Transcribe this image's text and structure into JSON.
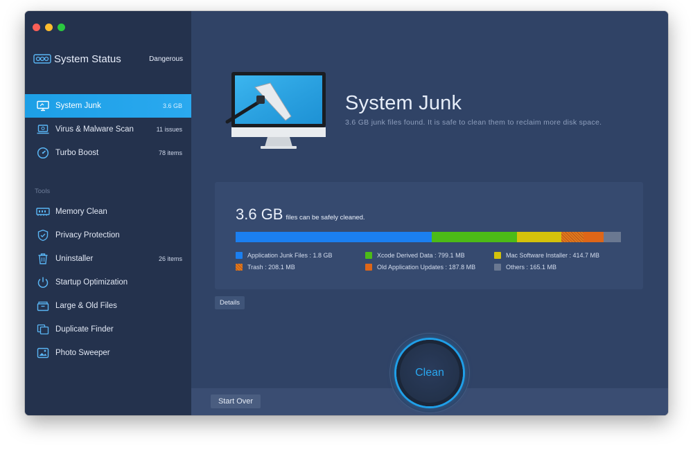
{
  "window": {
    "traffic_lights": [
      "close",
      "minimize",
      "zoom"
    ]
  },
  "sidebar": {
    "status": {
      "title": "System Status",
      "value": "Dangerous",
      "icon": "status-icon"
    },
    "scan_items": [
      {
        "label": "System Junk",
        "meta": "3.6 GB",
        "icon": "monitor-icon",
        "active": true
      },
      {
        "label": "Virus & Malware Scan",
        "meta": "11 issues",
        "icon": "laptop-scan-icon",
        "active": false
      },
      {
        "label": "Turbo Boost",
        "meta": "78 items",
        "icon": "speedometer-icon",
        "active": false
      }
    ],
    "tools_heading": "Tools",
    "tools": [
      {
        "label": "Memory Clean",
        "meta": "",
        "icon": "memory-chip-icon"
      },
      {
        "label": "Privacy Protection",
        "meta": "",
        "icon": "shield-icon"
      },
      {
        "label": "Uninstaller",
        "meta": "26 items",
        "icon": "trash-icon"
      },
      {
        "label": "Startup Optimization",
        "meta": "",
        "icon": "power-icon"
      },
      {
        "label": "Large & Old Files",
        "meta": "",
        "icon": "box-icon"
      },
      {
        "label": "Duplicate Finder",
        "meta": "",
        "icon": "duplicate-icon"
      },
      {
        "label": "Photo Sweeper",
        "meta": "",
        "icon": "photo-icon"
      }
    ]
  },
  "main": {
    "title": "System Junk",
    "subtitle": "3.6 GB junk files found.  It is safe to clean them to reclaim more disk space.",
    "summary": {
      "size": "3.6 GB",
      "text": "files can be safely cleaned."
    },
    "breakdown": [
      {
        "label": "Application Junk Files : 1.8 GB",
        "mb": 1843.2,
        "color": "#1b7ff0",
        "pattern": false
      },
      {
        "label": "Xcode Derived Data : 799.1 MB",
        "mb": 799.1,
        "color": "#4cbb17",
        "pattern": false
      },
      {
        "label": "Mac Software Installer : 414.7 MB",
        "mb": 414.7,
        "color": "#d4c20b",
        "pattern": false
      },
      {
        "label": "Trash : 208.1 MB",
        "mb": 208.1,
        "color": "#e07a1c",
        "pattern": true
      },
      {
        "label": "Old Application Updates : 187.8 MB",
        "mb": 187.8,
        "color": "#de6618",
        "pattern": false
      },
      {
        "label": "Others : 165.1 MB",
        "mb": 165.1,
        "color": "#6a7891",
        "pattern": false
      }
    ],
    "details_button": "Details",
    "clean_button": "Clean",
    "start_over_button": "Start Over"
  }
}
